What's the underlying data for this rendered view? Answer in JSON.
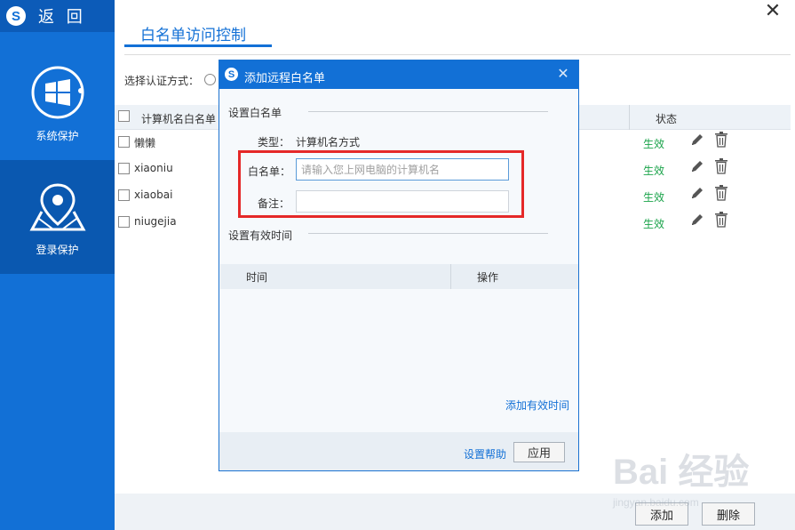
{
  "sidebar": {
    "back_label": "返 回",
    "logo_letter": "S",
    "items": [
      {
        "label": "系统保护",
        "icon": "windows-logo-icon"
      },
      {
        "label": "登录保护",
        "icon": "map-pin-icon"
      }
    ]
  },
  "header": {
    "title": "白名单访问控制",
    "close_glyph": "✕"
  },
  "auth": {
    "label": "选择认证方式："
  },
  "table": {
    "columns": [
      "计算机名白名单",
      "状态"
    ],
    "rows": [
      {
        "name": "懒懒",
        "status": "生效"
      },
      {
        "name": "xiaoniu",
        "status": "生效"
      },
      {
        "name": "xiaobai",
        "status": "生效"
      },
      {
        "name": "niugejia",
        "status": "生效"
      }
    ]
  },
  "footer": {
    "add_label": "添加",
    "delete_label": "删除"
  },
  "modal": {
    "title": "添加远程白名单",
    "logo_letter": "S",
    "close_glyph": "✕",
    "section1": "设置白名单",
    "type_label": "类型：",
    "type_value": "计算机名方式",
    "whitelist_label": "白名单：",
    "whitelist_placeholder": "请输入您上网电脑的计算机名",
    "note_label": "备注：",
    "section2": "设置有效时间",
    "table_columns": [
      "时间",
      "操作"
    ],
    "add_time_link": "添加有效时间",
    "help_link": "设置帮助",
    "apply_label": "应用"
  },
  "watermark": {
    "text": "Bai 经验",
    "sub": "jingyan.baidu.com"
  },
  "colors": {
    "brand": "#1270d6",
    "active_status": "#1aa34a",
    "highlight": "#e52828"
  }
}
